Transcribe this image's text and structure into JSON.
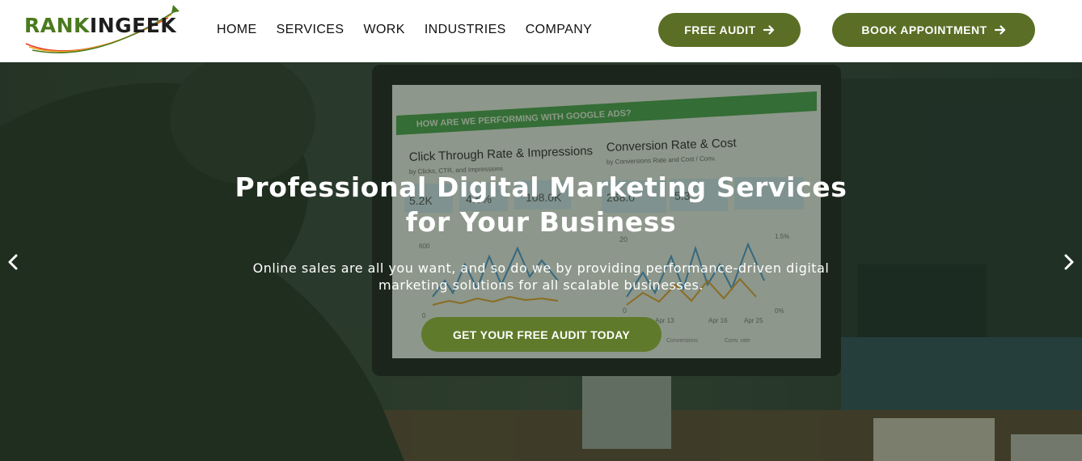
{
  "brand": {
    "logo_part1": "RANK",
    "logo_part2": "INGEEK",
    "green": "#4a7a1e",
    "dark": "#1d1d1d"
  },
  "nav": {
    "items": [
      {
        "label": "HOME"
      },
      {
        "label": "SERVICES"
      },
      {
        "label": "WORK"
      },
      {
        "label": "INDUSTRIES"
      },
      {
        "label": "COMPANY"
      }
    ]
  },
  "header_buttons": {
    "free_audit": "FREE AUDIT",
    "book_appointment": "BOOK APPOINTMENT",
    "color": "#5a6e25",
    "icon": "arrow-right-icon"
  },
  "hero": {
    "title_line1": "Professional Digital Marketing Services",
    "title_line2": "for Your Business",
    "subtitle_line1": "Online sales are all you want, and so do we by providing performance-driven digital",
    "subtitle_line2": "marketing solutions for all scalable businesses.",
    "cta_label": "GET YOUR FREE AUDIT TODAY",
    "prev_icon": "chevron-left-icon",
    "next_icon": "chevron-right-icon",
    "background": "office-monitor-dashboard-photo"
  },
  "monitor_screen": {
    "banner": "HOW ARE WE PERFORMING WITH GOOGLE ADS?",
    "panel1_title": "Click Through Rate & Impressions",
    "panel1_sub": "by Clicks, CTR, and Impressions",
    "panel1_stats": [
      "5.2K",
      "4.6%",
      "108.0K"
    ],
    "panel2_title": "Conversion Rate & Cost",
    "panel2_sub": "by Conversions Rate and Cost / Conv.",
    "panel2_stats": [
      "268.0",
      "5.3"
    ],
    "axis_left": [
      "600",
      "0"
    ],
    "axis_mid": [
      "20",
      "0"
    ],
    "axis_right": [
      "1.5%",
      "0%"
    ],
    "dates": [
      "Apr 13",
      "Apr 16",
      "Apr 25"
    ],
    "legend": [
      "Conversions",
      "Conv. rate"
    ]
  }
}
